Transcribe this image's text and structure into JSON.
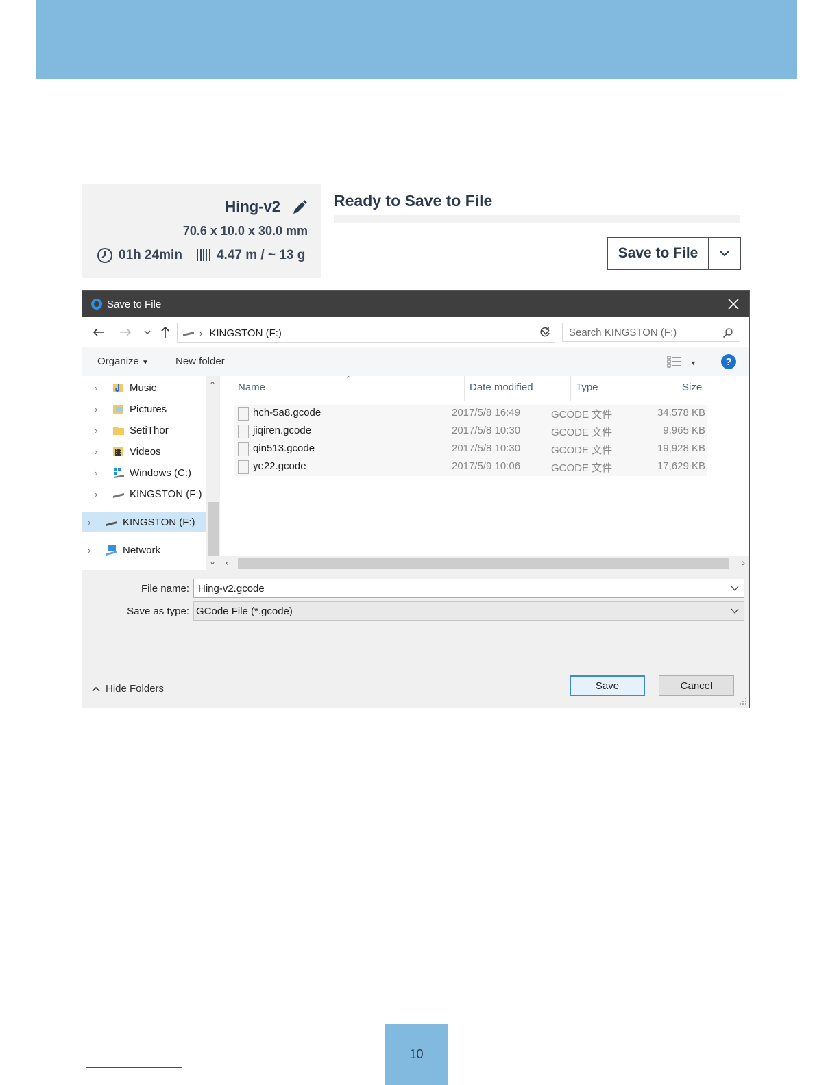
{
  "page": {
    "number": "10"
  },
  "cura": {
    "job_name": "Hing-v2",
    "dimensions": "70.6 x 10.0 x 30.0 mm",
    "print_time": "01h 24min",
    "material": "4.47 m / ~ 13 g",
    "status": "Ready to Save to File",
    "progress_fraction": 0.0,
    "save_button": "Save to File"
  },
  "dialog": {
    "title": "Save to File",
    "address": "KINGSTON (F:)",
    "search_placeholder": "Search KINGSTON (F:)",
    "toolbar": {
      "organize": "Organize",
      "new_folder": "New folder",
      "help": "?"
    },
    "nav_items": [
      {
        "label": "Music"
      },
      {
        "label": "Pictures"
      },
      {
        "label": "SetiThor"
      },
      {
        "label": "Videos"
      },
      {
        "label": "Windows (C:)"
      },
      {
        "label": "KINGSTON (F:)"
      },
      {
        "label": "KINGSTON (F:)",
        "selected": true
      },
      {
        "label": "Network"
      }
    ],
    "columns": {
      "name": "Name",
      "date": "Date modified",
      "type": "Type",
      "size": "Size"
    },
    "files": [
      {
        "name": "hch-5a8.gcode",
        "date": "2017/5/8 16:49",
        "type": "GCODE 文件",
        "size": "34,578 KB"
      },
      {
        "name": "jiqiren.gcode",
        "date": "2017/5/8 10:30",
        "type": "GCODE 文件",
        "size": "9,965 KB"
      },
      {
        "name": "qin513.gcode",
        "date": "2017/5/8 10:30",
        "type": "GCODE 文件",
        "size": "19,928 KB"
      },
      {
        "name": "ye22.gcode",
        "date": "2017/5/9 10:06",
        "type": "GCODE 文件",
        "size": "17,629 KB"
      }
    ],
    "file_name_label": "File name:",
    "file_name_value": "Hing-v2.gcode",
    "save_type_label": "Save as type:",
    "save_type_value": "GCode File (*.gcode)",
    "hide_folders": "Hide Folders",
    "save_button": "Save",
    "cancel_button": "Cancel"
  }
}
